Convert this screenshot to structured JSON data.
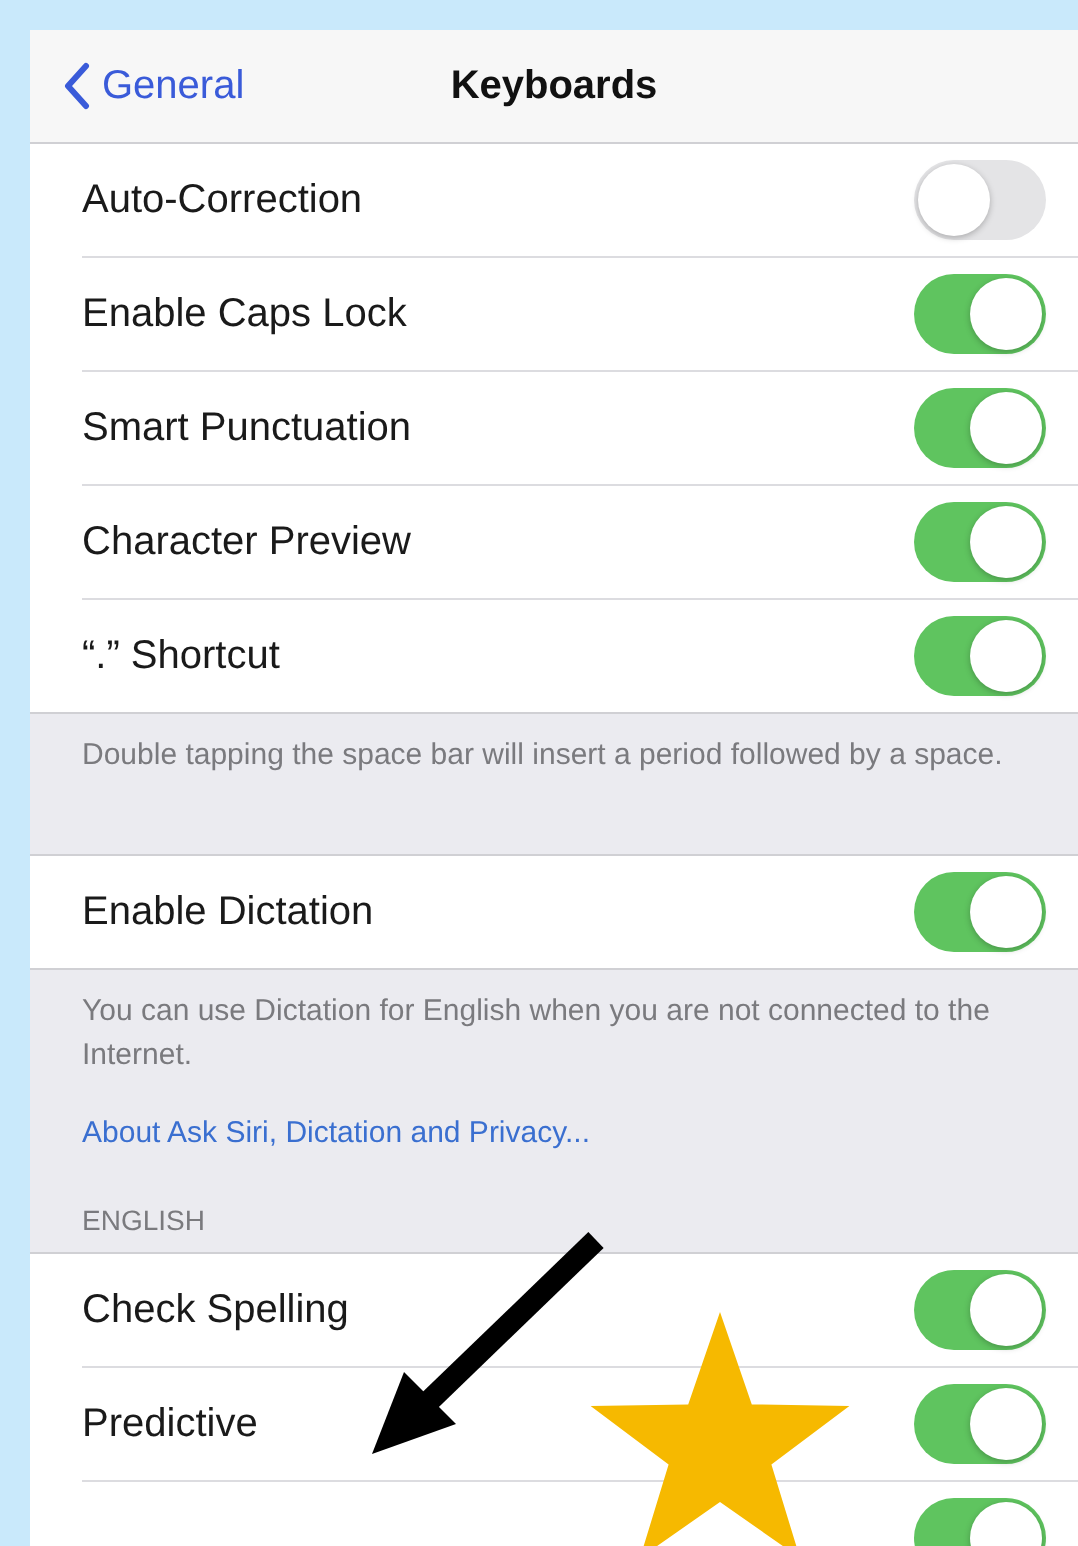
{
  "nav": {
    "back": "General",
    "title": "Keyboards"
  },
  "groups": [
    {
      "rows": [
        {
          "label": "Auto-Correction",
          "on": false
        },
        {
          "label": "Enable Caps Lock",
          "on": true
        },
        {
          "label": "Smart Punctuation",
          "on": true
        },
        {
          "label": "Character Preview",
          "on": true
        },
        {
          "label": "“.” Shortcut",
          "on": true
        }
      ],
      "footer": "Double tapping the space bar will insert a period followed by a space."
    },
    {
      "rows": [
        {
          "label": "Enable Dictation",
          "on": true
        }
      ],
      "footer": "You can use Dictation for English when you are not connected to the Internet.",
      "link": "About Ask Siri, Dictation and Privacy..."
    },
    {
      "header": "ENGLISH",
      "rows": [
        {
          "label": "Check Spelling",
          "on": true
        },
        {
          "label": "Predictive",
          "on": true
        },
        {
          "on": true
        }
      ]
    }
  ]
}
